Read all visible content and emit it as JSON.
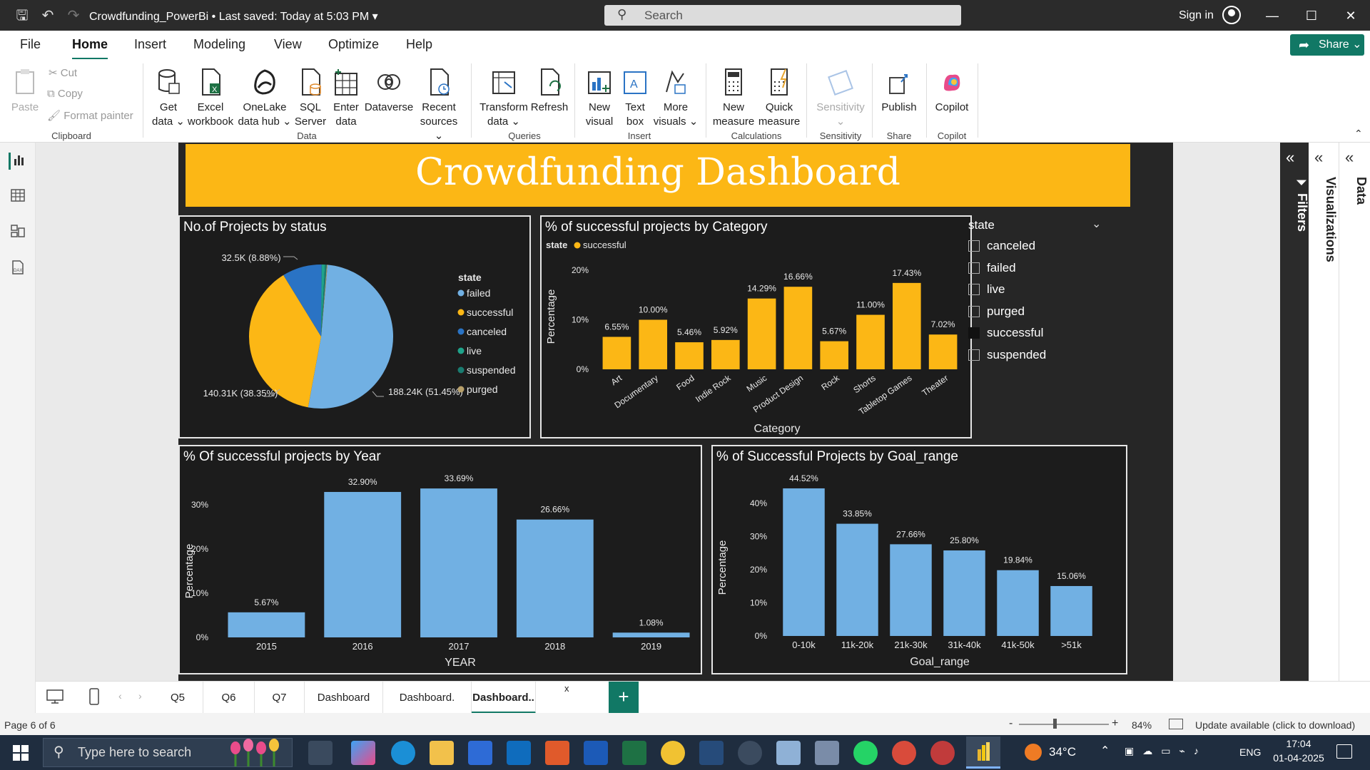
{
  "titlebar": {
    "doc_title": "Crowdfunding_PowerBi • Last saved: Today at 5:03 PM",
    "search_placeholder": "Search",
    "signin": "Sign in"
  },
  "menu": [
    "File",
    "Home",
    "Insert",
    "Modeling",
    "View",
    "Optimize",
    "Help"
  ],
  "share_label": "Share",
  "ribbon": {
    "clipboard": {
      "paste": "Paste",
      "cut": "Cut",
      "copy": "Copy",
      "format_painter": "Format painter",
      "label": "Clipboard"
    },
    "data_buttons": [
      {
        "l1": "Get",
        "l2": "data ⌄"
      },
      {
        "l1": "Excel",
        "l2": "workbook"
      },
      {
        "l1": "OneLake",
        "l2": "data hub ⌄"
      },
      {
        "l1": "SQL",
        "l2": "Server"
      },
      {
        "l1": "Enter",
        "l2": "data"
      },
      {
        "l1": "Dataverse",
        "l2": ""
      },
      {
        "l1": "Recent",
        "l2": "sources ⌄"
      }
    ],
    "data_label": "Data",
    "queries_buttons": [
      {
        "l1": "Transform",
        "l2": "data ⌄"
      },
      {
        "l1": "Refresh",
        "l2": ""
      }
    ],
    "queries_label": "Queries",
    "insert_buttons": [
      {
        "l1": "New",
        "l2": "visual"
      },
      {
        "l1": "Text",
        "l2": "box"
      },
      {
        "l1": "More",
        "l2": "visuals ⌄"
      }
    ],
    "insert_label": "Insert",
    "calc_buttons": [
      {
        "l1": "New",
        "l2": "measure"
      },
      {
        "l1": "Quick",
        "l2": "measure"
      }
    ],
    "calc_label": "Calculations",
    "sensitivity_button": {
      "l1": "Sensitivity",
      "l2": "⌄"
    },
    "sensitivity_label": "Sensitivity",
    "publish_button": "Publish",
    "share_group_label": "Share",
    "copilot_button": "Copilot",
    "copilot_label": "Copilot"
  },
  "dashboard_title": "Crowdfunding Dashboard",
  "slicer": {
    "title": "state",
    "items": [
      "canceled",
      "failed",
      "live",
      "purged",
      "successful",
      "suspended"
    ],
    "checked": "successful"
  },
  "panes": {
    "filters": "Filters",
    "visualizations": "Visualizations",
    "data": "Data"
  },
  "tabs": [
    "Q5",
    "Q6",
    "Q7",
    "Dashboard",
    "Dashboard.",
    "Dashboard.."
  ],
  "status": {
    "page": "Page 6 of 6",
    "zoom": "84%",
    "update": "Update available (click to download)"
  },
  "taskbar": {
    "search": "Type here to search",
    "temp": "34°C",
    "lang": "ENG",
    "time": "17:04",
    "date": "01-04-2025"
  },
  "colors": {
    "accent": "#117865",
    "header": "#fcb715",
    "bar_blue": "#71b0e3",
    "bar_yellow": "#fcb715"
  },
  "chart_data": [
    {
      "type": "pie",
      "title": "No.of Projects by status",
      "legend_title": "state",
      "legend": [
        "failed",
        "successful",
        "canceled",
        "live",
        "suspended",
        "purged"
      ],
      "series": [
        {
          "name": "failed",
          "value": 188.24,
          "label": "188.24K (51.45%)",
          "color": "#71b0e3"
        },
        {
          "name": "successful",
          "value": 140.31,
          "label": "140.31K (38.35%)",
          "color": "#fcb715"
        },
        {
          "name": "canceled",
          "value": 32.5,
          "label": "32.5K (8.88%)",
          "color": "#2a73c4"
        },
        {
          "name": "live",
          "value": 2.7,
          "label": "",
          "color": "#1fa38a"
        },
        {
          "name": "suspended",
          "value": 1.5,
          "label": "",
          "color": "#1a7c70"
        },
        {
          "name": "purged",
          "value": 0.6,
          "label": "",
          "color": "#b8a06a"
        }
      ]
    },
    {
      "type": "bar",
      "title": "% of successful projects by Category",
      "legend_title": "state",
      "legend": [
        "successful"
      ],
      "categories": [
        "Art",
        "Documentary",
        "Food",
        "Indie Rock",
        "Music",
        "Product Design",
        "Rock",
        "Shorts",
        "Tabletop Games",
        "Theater"
      ],
      "values": [
        6.55,
        10.0,
        5.46,
        5.92,
        14.29,
        16.66,
        5.67,
        11.0,
        17.43,
        7.02
      ],
      "labels": [
        "6.55%",
        "10.00%",
        "5.46%",
        "5.92%",
        "14.29%",
        "16.66%",
        "5.67%",
        "11.00%",
        "17.43%",
        "7.02%"
      ],
      "xlabel": "Category",
      "ylabel": "Percentage",
      "yticks": [
        "0%",
        "10%",
        "20%"
      ],
      "ylim": [
        0,
        20
      ]
    },
    {
      "type": "bar",
      "title": "% Of successful projects by Year",
      "categories": [
        "2015",
        "2016",
        "2017",
        "2018",
        "2019"
      ],
      "values": [
        5.67,
        32.9,
        33.69,
        26.66,
        1.08
      ],
      "labels": [
        "5.67%",
        "32.90%",
        "33.69%",
        "26.66%",
        "1.08%"
      ],
      "xlabel": "YEAR",
      "ylabel": "Percentage",
      "yticks": [
        "0%",
        "10%",
        "20%",
        "30%"
      ],
      "ylim": [
        0,
        30
      ]
    },
    {
      "type": "bar",
      "title": "% of Successful Projects by Goal_range",
      "categories": [
        "0-10k",
        "11k-20k",
        "21k-30k",
        "31k-40k",
        "41k-50k",
        ">51k"
      ],
      "values": [
        44.52,
        33.85,
        27.66,
        25.8,
        19.84,
        15.06
      ],
      "labels": [
        "44.52%",
        "33.85%",
        "27.66%",
        "25.80%",
        "19.84%",
        "15.06%"
      ],
      "xlabel": "Goal_range",
      "ylabel": "Percentage",
      "yticks": [
        "0%",
        "10%",
        "20%",
        "30%",
        "40%"
      ],
      "ylim": [
        0,
        40
      ]
    }
  ]
}
